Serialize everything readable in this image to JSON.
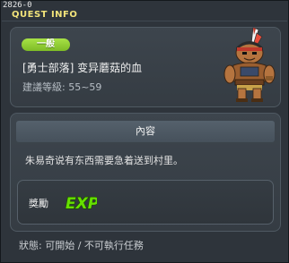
{
  "window": {
    "id_label": "2826-0",
    "title": "QUEST INFO"
  },
  "quest": {
    "category": "一般",
    "name": "[勇士部落] 变异蘑菇的血",
    "level_text": "建議等級: 55~59"
  },
  "content": {
    "header": "內容",
    "description": "朱易奇说有东西需要急着送到村里。",
    "reward_label": "獎勵",
    "reward_icon": "EXP"
  },
  "status": {
    "text": "狀態: 可開始 / 不可執行任務"
  },
  "colors": {
    "tag_green": "#8fcd35",
    "title_yellow": "#f2e37a",
    "exp_green": "#66e000"
  }
}
